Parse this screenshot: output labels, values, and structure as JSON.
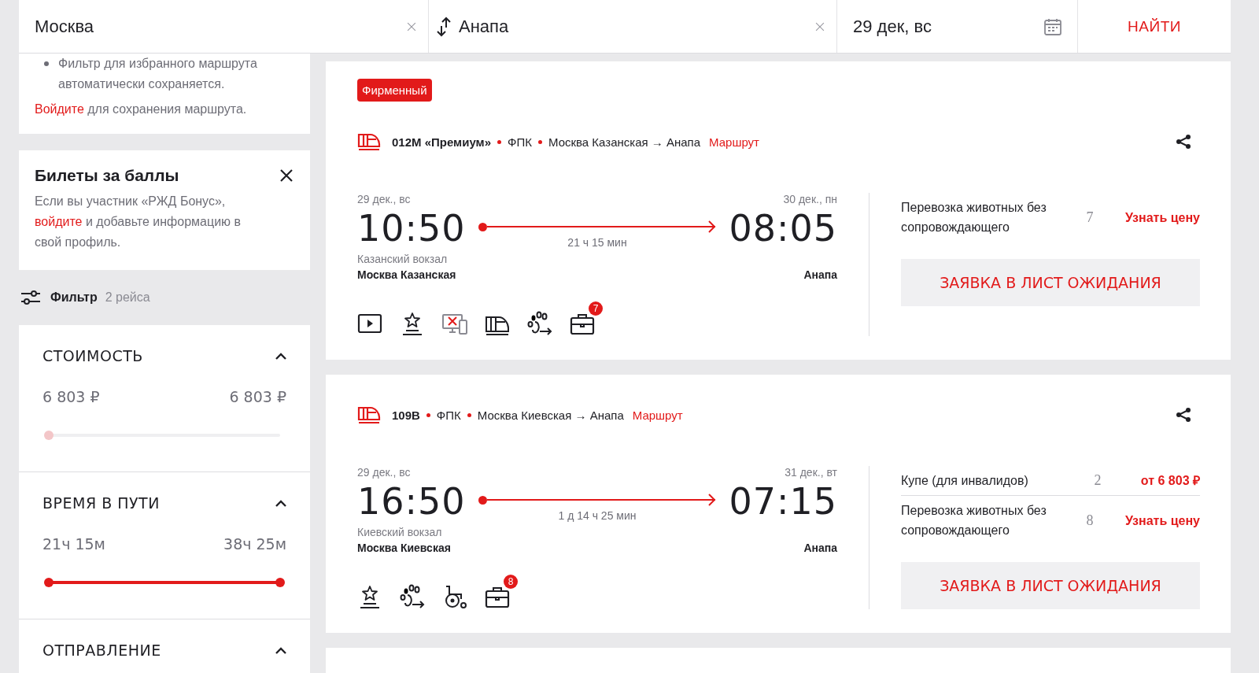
{
  "search": {
    "from": {
      "value": "Москва"
    },
    "to": {
      "value": "Анапа"
    },
    "date": {
      "value": "29 дек, вс"
    },
    "find_button": "НАЙТИ"
  },
  "favorite_note": {
    "bullets": [
      "Фильтр для избранного маршрута автоматически сохраняется."
    ],
    "link": "Войдите",
    "text": "для сохранения маршрута."
  },
  "bonus_card": {
    "title": "Билеты за баллы",
    "text_before": "Если вы участник «РЖД Бонус»,",
    "link": "войдите",
    "text_after": "и добавьте информацию в свой профиль."
  },
  "filter": {
    "label": "Фильтр",
    "count": "2 рейса"
  },
  "filter_sections": [
    {
      "title": "СТОИМОСТЬ",
      "expanded": true,
      "min": "6 803 ₽",
      "max": "6 803 ₽",
      "disabled": true,
      "level": 0
    },
    {
      "title": "ВРЕМЯ В ПУТИ",
      "expanded": true,
      "min": "21ч 15м",
      "max": "38ч 25м",
      "disabled": false,
      "level": 1
    },
    {
      "title": "ОТПРАВЛЕНИЕ",
      "expanded": true
    }
  ],
  "trains": [
    {
      "tag": "Фирменный",
      "number": "012М «Премиум»",
      "carrier": "ФПК",
      "route": "Москва Казанская → Анапа",
      "route_link": "Маршрут",
      "departure": {
        "date": "29 дек., вс",
        "time": "10:50",
        "station": "Казанский вокзал",
        "city": "Москва Казанская"
      },
      "duration": "21 ч 15 мин",
      "arrival": {
        "date": "30 дек., пн",
        "time": "08:05",
        "city": "Анапа"
      },
      "amenities": [
        {
          "kind": "video"
        },
        {
          "kind": "star"
        },
        {
          "kind": "no-screen"
        },
        {
          "kind": "train"
        },
        {
          "kind": "pets"
        },
        {
          "kind": "luggage",
          "badge": "7"
        }
      ],
      "seats": [
        {
          "name": "Перевозка животных без сопровождающего",
          "count": "7",
          "price": "Узнать цену"
        }
      ],
      "waitlist_button": "ЗАЯВКА В ЛИСТ ОЖИДАНИЯ"
    },
    {
      "number": "109В",
      "carrier": "ФПК",
      "route": "Москва Киевская → Анапа",
      "route_link": "Маршрут",
      "departure": {
        "date": "29 дек., вс",
        "time": "16:50",
        "station": "Киевский вокзал",
        "city": "Москва Киевская"
      },
      "duration": "1 д 14 ч 25 мин",
      "arrival": {
        "date": "31 дек., вт",
        "time": "07:15",
        "city": "Анапа"
      },
      "amenities": [
        {
          "kind": "star"
        },
        {
          "kind": "pets"
        },
        {
          "kind": "wheelchair"
        },
        {
          "kind": "luggage",
          "badge": "8"
        }
      ],
      "seats": [
        {
          "name": "Купе (для инвалидов)",
          "count": "2",
          "price": "от 6 803 ₽"
        },
        {
          "name": "Перевозка животных без сопровождающего",
          "count": "8",
          "price": "Узнать цену"
        }
      ],
      "waitlist_button": "ЗАЯВКА В ЛИСТ ОЖИДАНИЯ"
    }
  ]
}
